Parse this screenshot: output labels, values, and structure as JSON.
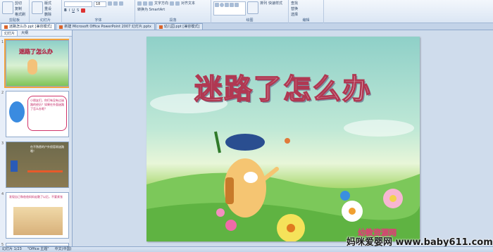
{
  "ribbon": {
    "groups": [
      {
        "label": "剪贴板",
        "items": [
          "粘贴",
          "剪切",
          "复制",
          "格式刷"
        ]
      },
      {
        "label": "幻灯片",
        "items": [
          "新建幻灯片",
          "版式",
          "重设",
          "删除"
        ]
      },
      {
        "label": "字体",
        "font_size": "18",
        "items": [
          "B",
          "I",
          "U",
          "S"
        ]
      },
      {
        "label": "段落",
        "items": [
          "文字方向",
          "对齐文本",
          "转换为 SmartArt"
        ]
      },
      {
        "label": "绘图",
        "items": [
          "排列",
          "快速样式"
        ]
      },
      {
        "label": "编辑",
        "items": [
          "查找",
          "替换",
          "选择"
        ]
      }
    ]
  },
  "doc_tabs": [
    {
      "label": "迷路怎么办.ppt [兼容模式]"
    },
    {
      "label": "新建 Microsoft Office PowerPoint 2007 幻灯片.pptx"
    },
    {
      "label": "幼儿园.ppt [兼容模式]"
    }
  ],
  "panel": {
    "tabs": [
      "幻灯片",
      "大纲"
    ],
    "thumbs": [
      {
        "num": "1",
        "text": "迷路了怎么办"
      },
      {
        "num": "2",
        "text": "小朋友们，你们有没有过迷路的经历？如果在外面迷路了怎么办呢？"
      },
      {
        "num": "3",
        "text": "在不熟悉的户外很容易迷路哦！"
      },
      {
        "num": "4",
        "text": "发现自己和爸爸妈妈走散了以后，不要紧张"
      },
      {
        "num": "5",
        "text": ""
      }
    ]
  },
  "slide": {
    "title": "迷路了怎么办",
    "logo_text": "幼教资源网"
  },
  "watermark": "妈咪爱婴网 www.baby611.com",
  "status": {
    "slide_pos": "幻灯片 1/23",
    "theme": "\"Office 主题\"",
    "lang": "中文(中国)"
  },
  "colors": {
    "title_stroke": "#b03852",
    "selection": "#f2a33c",
    "ribbon_bg": "#dbe6f4"
  }
}
